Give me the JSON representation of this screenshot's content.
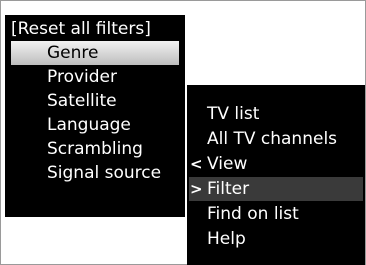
{
  "filter_menu": {
    "items": [
      {
        "label": "[Reset all filters]"
      },
      {
        "label": "Genre"
      },
      {
        "label": "Provider"
      },
      {
        "label": "Satellite"
      },
      {
        "label": "Language"
      },
      {
        "label": "Scrambling"
      },
      {
        "label": "Signal source"
      }
    ],
    "selected": "Genre"
  },
  "main_menu": {
    "items": [
      {
        "label": "TV list",
        "arrow": ""
      },
      {
        "label": "All TV channels",
        "arrow": ""
      },
      {
        "label": "View",
        "arrow": "<"
      },
      {
        "label": "Filter",
        "arrow": ">"
      },
      {
        "label": "Find on list",
        "arrow": ""
      },
      {
        "label": "Help",
        "arrow": ""
      }
    ],
    "selected": "Filter"
  },
  "colors": {
    "menu_background": "#000000",
    "menu_text": "#ffffff",
    "selection_light": "#d8d8d8",
    "selection_dark": "#3a3a3a"
  }
}
